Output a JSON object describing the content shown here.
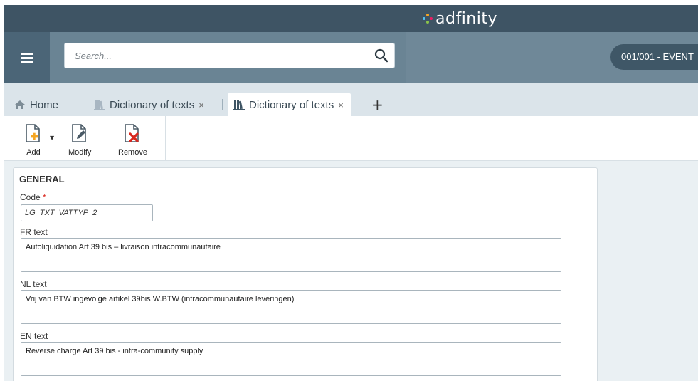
{
  "app": {
    "brand": "adfinity",
    "company": "001/001 - EVENT"
  },
  "search": {
    "placeholder": "Search...",
    "value": ""
  },
  "tabs": [
    {
      "label": "Home",
      "icon": "home-icon"
    },
    {
      "label": "Dictionary of texts",
      "icon": "book-icon",
      "close": "×"
    },
    {
      "label": "Dictionary of texts",
      "icon": "book-icon",
      "close": "×"
    }
  ],
  "tab_add": "+",
  "toolbar": {
    "add_label": "Add",
    "modify_label": "Modify",
    "remove_label": "Remove"
  },
  "form": {
    "section_title": "GENERAL",
    "code_label": "Code",
    "code_required": "*",
    "code_value": "LG_TXT_VATTYP_2",
    "fr_label": "FR text",
    "fr_value": "Autoliquidation Art 39 bis – livraison intracommunautaire",
    "nl_label": "NL text",
    "nl_value": "Vrij van BTW ingevolge artikel 39bis W.BTW (intracommunautaire leveringen)",
    "en_label": "EN text",
    "en_value": "Reverse charge Art 39 bis - intra-community supply"
  },
  "colors": {
    "topbar": "#3e5464",
    "searchbar": "#6f8898",
    "accent_orange": "#f5a623",
    "remove_red": "#d9281e"
  }
}
